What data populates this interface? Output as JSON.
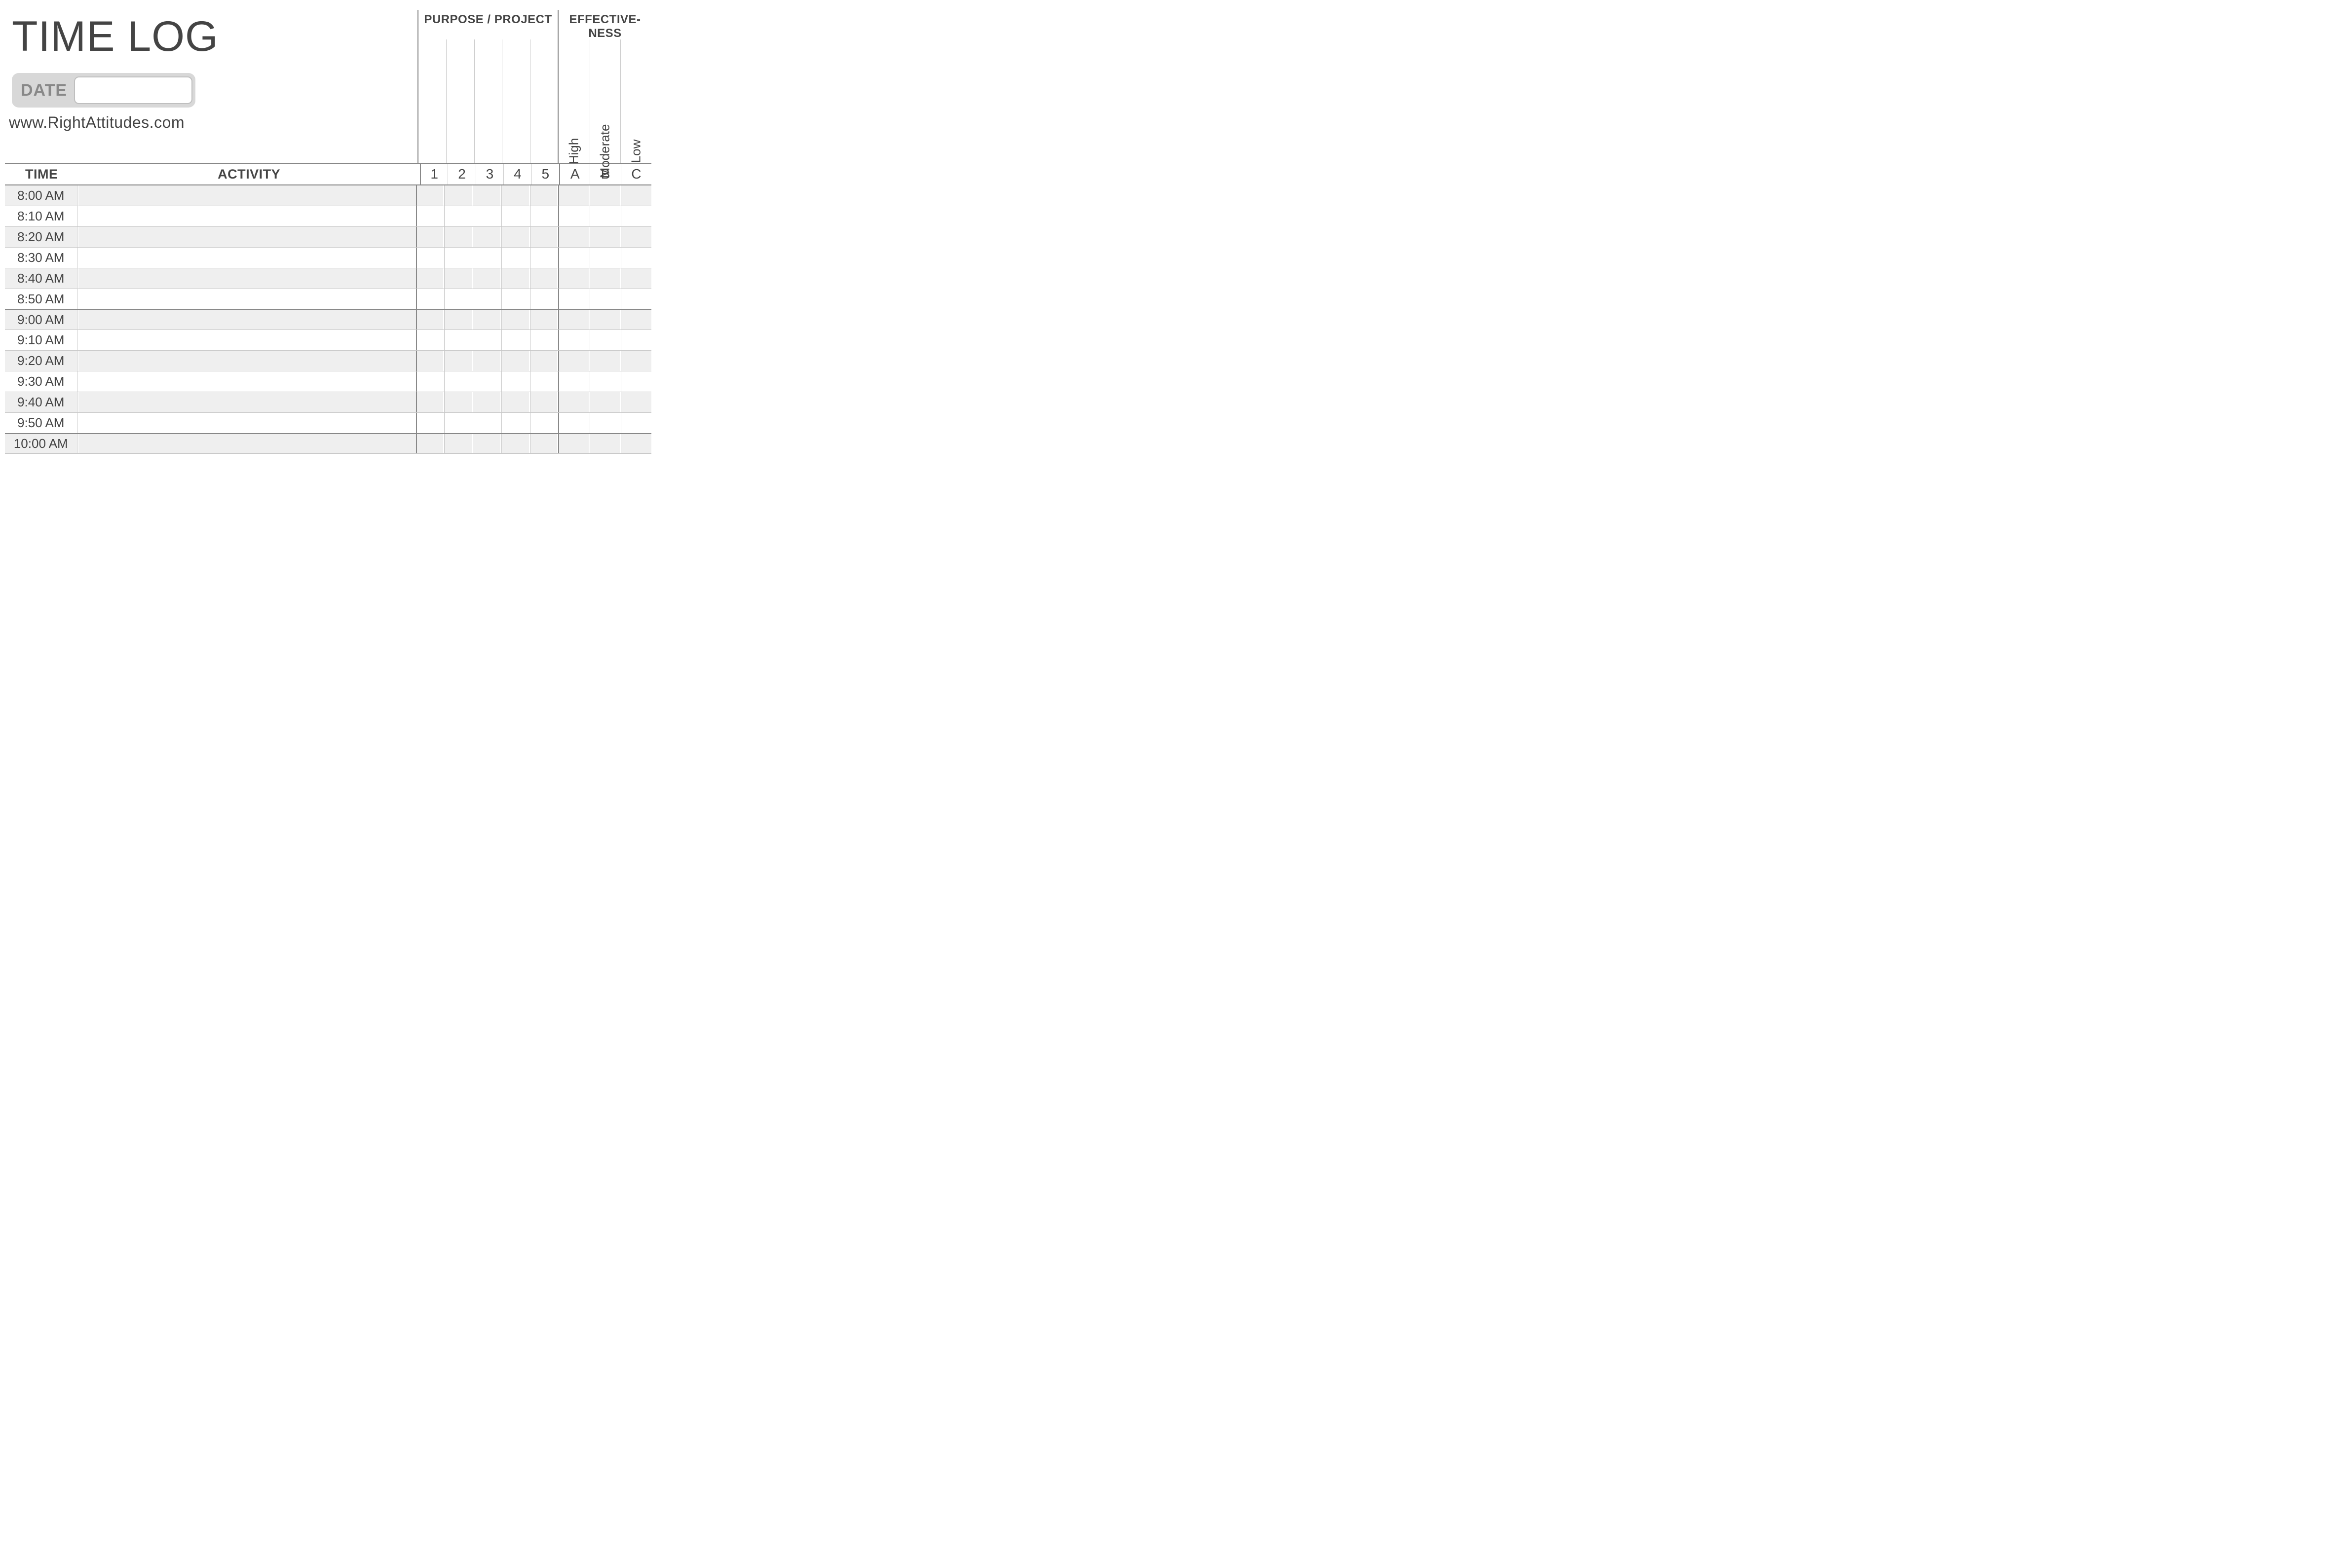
{
  "title": "TIME LOG",
  "date_label": "DATE",
  "date_value": "",
  "site": "www.RightAttitudes.com",
  "purpose_header": "PURPOSE / PROJECT",
  "effectiveness_header_line1": "EFFECTIVE-",
  "effectiveness_header_line2": "NESS",
  "purpose_cols": [
    "1",
    "2",
    "3",
    "4",
    "5"
  ],
  "effectiveness_labels": [
    "High",
    "Moderate",
    "Low"
  ],
  "effectiveness_cols": [
    "A",
    "B",
    "C"
  ],
  "col_time": "TIME",
  "col_activity": "ACTIVITY",
  "times": [
    "8:00 AM",
    "8:10 AM",
    "8:20 AM",
    "8:30 AM",
    "8:40 AM",
    "8:50 AM",
    "9:00 AM",
    "9:10 AM",
    "9:20 AM",
    "9:30 AM",
    "9:40 AM",
    "9:50 AM",
    "10:00 AM"
  ]
}
